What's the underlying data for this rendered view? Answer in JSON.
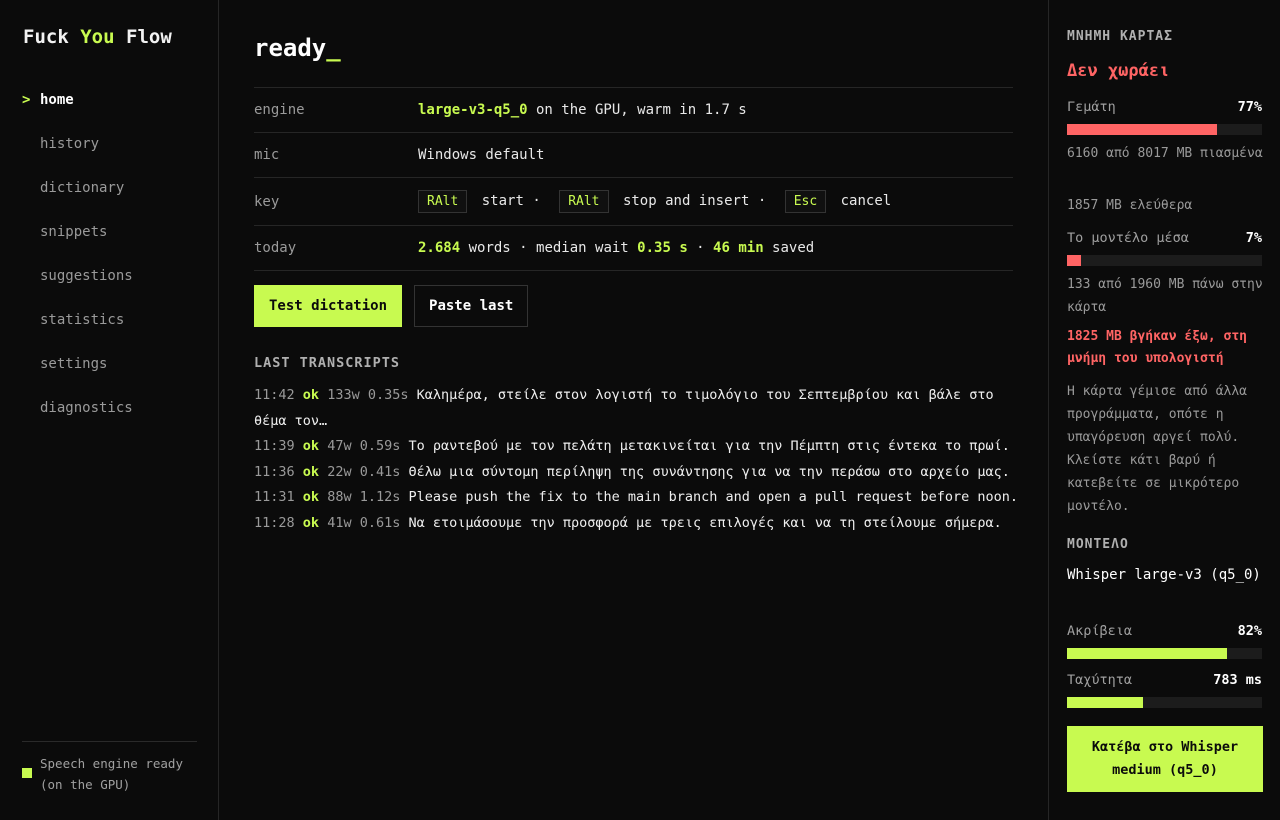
{
  "brand": {
    "part1": "Fuck",
    "part2": "You",
    "part3": "Flow"
  },
  "nav": {
    "caret": ">",
    "items": [
      {
        "label": "home"
      },
      {
        "label": "history"
      },
      {
        "label": "dictionary"
      },
      {
        "label": "snippets"
      },
      {
        "label": "suggestions"
      },
      {
        "label": "statistics"
      },
      {
        "label": "settings"
      },
      {
        "label": "diagnostics"
      }
    ]
  },
  "status": {
    "text_line1": "Speech engine ready",
    "text_line2": "(on the GPU)"
  },
  "main": {
    "title": "ready",
    "title_cursor": "_",
    "engine": {
      "key": "engine",
      "model": "large-v3-q5_0",
      "rest": " on the GPU, warm in 1.7 s"
    },
    "mic": {
      "key": "mic",
      "value": "Windows default"
    },
    "keys": {
      "key": "key",
      "k1": "RAlt",
      "t1": "start ·",
      "k2": "RAlt",
      "t2": "stop and insert ·",
      "k3": "Esc",
      "t3": "cancel"
    },
    "today": {
      "key": "today",
      "words": "2.684",
      "words_label": " words · median wait ",
      "wait": "0.35 s",
      "sep": " · ",
      "saved": "46 min",
      "saved_label": " saved"
    },
    "buttons": {
      "test": "Test dictation",
      "paste": "Paste last"
    },
    "transcripts_label": "LAST TRANSCRIPTS",
    "transcripts": [
      {
        "time": "11:42",
        "status": "ok",
        "meta": "133w 0.35s",
        "text": "Καλημέρα, στείλε στον λογιστή το τιμολόγιο του Σεπτεμβρίου και βάλε στο θέμα τον…"
      },
      {
        "time": "11:39",
        "status": "ok",
        "meta": "47w 0.59s",
        "text": "Το ραντεβού με τον πελάτη μετακινείται για την Πέμπτη στις έντεκα το πρωί."
      },
      {
        "time": "11:36",
        "status": "ok",
        "meta": "22w 0.41s",
        "text": "Θέλω μια σύντομη περίληψη της συνάντησης για να την περάσω στο αρχείο μας."
      },
      {
        "time": "11:31",
        "status": "ok",
        "meta": "88w 1.12s",
        "text": "Please push the fix to the main branch and open a pull request before noon."
      },
      {
        "time": "11:28",
        "status": "ok",
        "meta": "41w 0.61s",
        "text": "Να ετοιμάσουμε την προσφορά με τρεις επιλογές και να τη στείλουμε σήμερα."
      }
    ]
  },
  "panel": {
    "vram_label": "ΜΝΗΜΗ ΚΑΡΤΑΣ",
    "alert": "Δεν χωράει",
    "full_label": "Γεμάτη",
    "full_pct": "77%",
    "full_value": 0.77,
    "used_text": "6160 από 8017 MB πιασμένα",
    "free_text": "1857 MB ελεύθερα",
    "model_in_label": "Το μοντέλο μέσα",
    "model_in_pct": "7%",
    "model_in_value": 0.07,
    "model_on_card": "133 από 1960 MB πάνω στην κάρτα",
    "spilled": "1825 MB βγήκαν έξω, στη μνήμη του υπολογιστή",
    "explain": "Η κάρτα γέμισε από άλλα προγράμματα, οπότε η υπαγόρευση αργεί πολύ. Κλείστε κάτι βαρύ ή κατεβείτε σε μικρότερο μοντέλο.",
    "model_label": "ΜΟΝΤΕΛΟ",
    "model_name": "Whisper large-v3 (q5_0)",
    "accuracy_label": "Ακρίβεια",
    "accuracy_pct": "82%",
    "accuracy_value": 0.82,
    "speed_label": "Ταχύτητα",
    "speed_value_text": "783 ms",
    "speed_value": 0.39,
    "cta": "Κατέβα στο Whisper medium (q5_0)"
  },
  "colors": {
    "accent": "#c8fa50",
    "danger": "#ff6464",
    "background": "#0b0b0b"
  }
}
